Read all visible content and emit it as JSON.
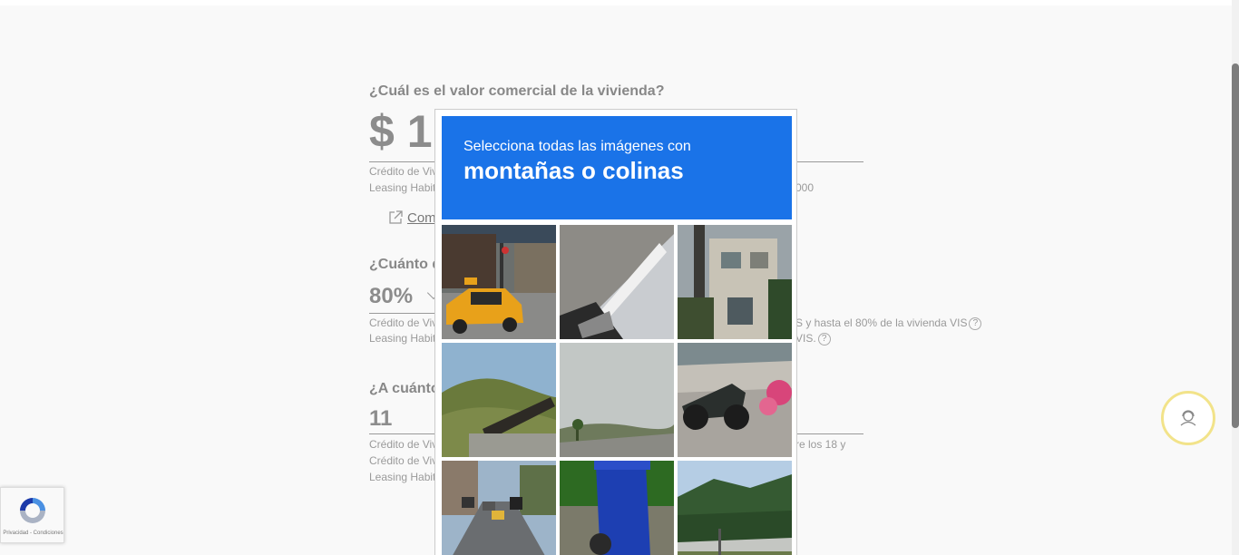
{
  "form": {
    "q1": "¿Cuál es el valor comercial de la vivienda?",
    "q1_value": "$ 1",
    "q1_note1": "Crédito de Viv",
    "q1_note2": "Leasing Habit",
    "q1_note2_right": "000",
    "link_label": "Com",
    "q2": "¿Cuánto d",
    "q2_value": "80%",
    "q2_note1": "Crédito de Viv",
    "q2_note1_right": "S y hasta el 80% de la vivienda VIS",
    "q2_note2": "Leasing Habit",
    "q2_note2_right": "VIS.",
    "q3": "¿A cuánto",
    "q3_value": "11",
    "q3_note1": "Crédito de Viv",
    "q3_note1_right": "re los 18 y",
    "q3_note2": "Crédito de Viv",
    "q3_note3": "Leasing Habit",
    "help_glyph": "?"
  },
  "captcha": {
    "instruction": "Selecciona todas las imágenes con",
    "object": "montañas o colinas",
    "header_color": "#1a73e8",
    "tiles": [
      "taxi-street",
      "car-roof-closeup",
      "building-palm",
      "hill-sign",
      "cloudy-hills",
      "motorcycle-flowers",
      "street-cars",
      "blue-trash-bin",
      "forest-mountain"
    ]
  },
  "badge": {
    "text": "Privacidad - Condiciones"
  },
  "colors": {
    "assist_ring": "#f2e38a",
    "recaptcha_blue": "#1a73e8"
  }
}
